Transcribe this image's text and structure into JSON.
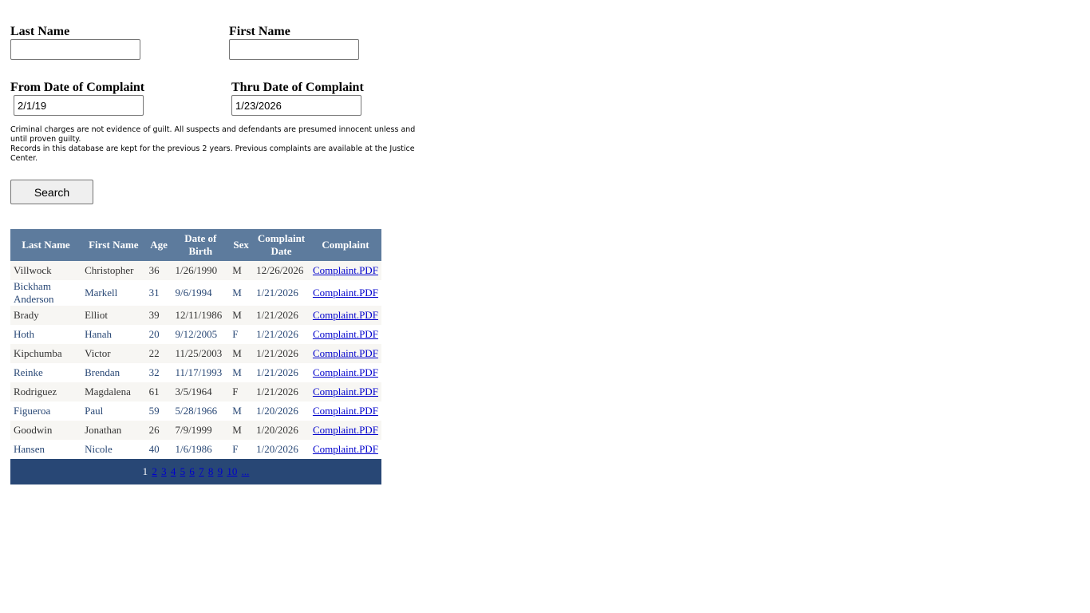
{
  "form": {
    "last_name_label": "Last Name",
    "last_name_value": "",
    "first_name_label": "First Name",
    "first_name_value": "",
    "from_date_label": "From Date of Complaint",
    "from_date_value": "2/1/19",
    "thru_date_label": "Thru Date of Complaint",
    "thru_date_value": "1/23/2026",
    "disclaimer_line1": "Criminal charges are not evidence of guilt. All suspects and defendants are presumed innocent unless and until proven guilty.",
    "disclaimer_line2": "Records in this database are kept for the previous 2 years.  Previous complaints are available at the Justice Center.",
    "search_label": "Search"
  },
  "table": {
    "headers": [
      "Last Name",
      "First Name",
      "Age",
      "Date of Birth",
      "Sex",
      "Complaint Date",
      "Complaint"
    ],
    "rows": [
      {
        "last": "Villwock",
        "first": "Christopher",
        "age": "36",
        "dob": "1/26/1990",
        "sex": "M",
        "date": "12/26/2026",
        "link": "Complaint.PDF"
      },
      {
        "last": "Bickham Anderson",
        "first": "Markell",
        "age": "31",
        "dob": "9/6/1994",
        "sex": "M",
        "date": "1/21/2026",
        "link": "Complaint.PDF"
      },
      {
        "last": "Brady",
        "first": "Elliot",
        "age": "39",
        "dob": "12/11/1986",
        "sex": "M",
        "date": "1/21/2026",
        "link": "Complaint.PDF"
      },
      {
        "last": "Hoth",
        "first": "Hanah",
        "age": "20",
        "dob": "9/12/2005",
        "sex": "F",
        "date": "1/21/2026",
        "link": "Complaint.PDF"
      },
      {
        "last": "Kipchumba",
        "first": "Victor",
        "age": "22",
        "dob": "11/25/2003",
        "sex": "M",
        "date": "1/21/2026",
        "link": "Complaint.PDF"
      },
      {
        "last": "Reinke",
        "first": "Brendan",
        "age": "32",
        "dob": "11/17/1993",
        "sex": "M",
        "date": "1/21/2026",
        "link": "Complaint.PDF"
      },
      {
        "last": "Rodriguez",
        "first": "Magdalena",
        "age": "61",
        "dob": "3/5/1964",
        "sex": "F",
        "date": "1/21/2026",
        "link": "Complaint.PDF"
      },
      {
        "last": "Figueroa",
        "first": "Paul",
        "age": "59",
        "dob": "5/28/1966",
        "sex": "M",
        "date": "1/20/2026",
        "link": "Complaint.PDF"
      },
      {
        "last": "Goodwin",
        "first": "Jonathan",
        "age": "26",
        "dob": "7/9/1999",
        "sex": "M",
        "date": "1/20/2026",
        "link": "Complaint.PDF"
      },
      {
        "last": "Hansen",
        "first": "Nicole",
        "age": "40",
        "dob": "1/6/1986",
        "sex": "F",
        "date": "1/20/2026",
        "link": "Complaint.PDF"
      }
    ],
    "pager": {
      "current": "1",
      "pages": [
        "2",
        "3",
        "4",
        "5",
        "6",
        "7",
        "8",
        "9",
        "10",
        "..."
      ]
    }
  },
  "colors": {
    "header_bg": "#5d7b9d",
    "pager_bg": "#284775",
    "row_alt_bg": "#f7f6f3",
    "link": "#0000cc"
  }
}
